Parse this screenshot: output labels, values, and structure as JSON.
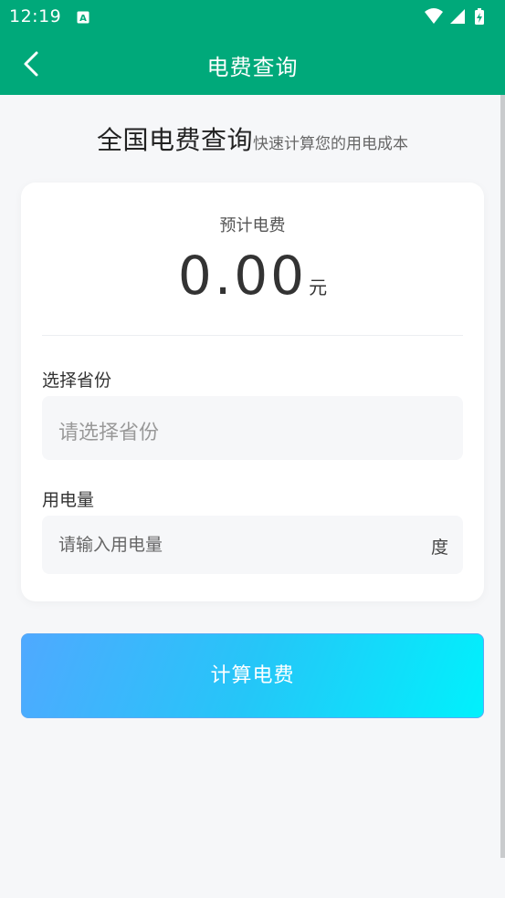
{
  "status_bar": {
    "time": "12:19",
    "notification_icon": "a-notification-icon",
    "icons": [
      "wifi-icon",
      "cell-signal-icon",
      "battery-charging-icon"
    ]
  },
  "app_bar": {
    "title": "电费查询",
    "back_icon": "chevron-left-icon"
  },
  "headline": {
    "title": "全国电费查询",
    "subtitle": "快速计算您的用电成本"
  },
  "estimate": {
    "label": "预计电费",
    "amount": "0.00",
    "unit": "元"
  },
  "province": {
    "label": "选择省份",
    "placeholder": "请选择省份"
  },
  "usage": {
    "label": "用电量",
    "placeholder": "请输入用电量",
    "value": "",
    "unit": "度"
  },
  "calculate_button": {
    "label": "计算电费"
  },
  "colors": {
    "brand_green": "#00a97a",
    "button_gradient_start": "#4fa9ff",
    "button_gradient_end": "#00f1fc",
    "page_background": "#f6f7f9"
  }
}
